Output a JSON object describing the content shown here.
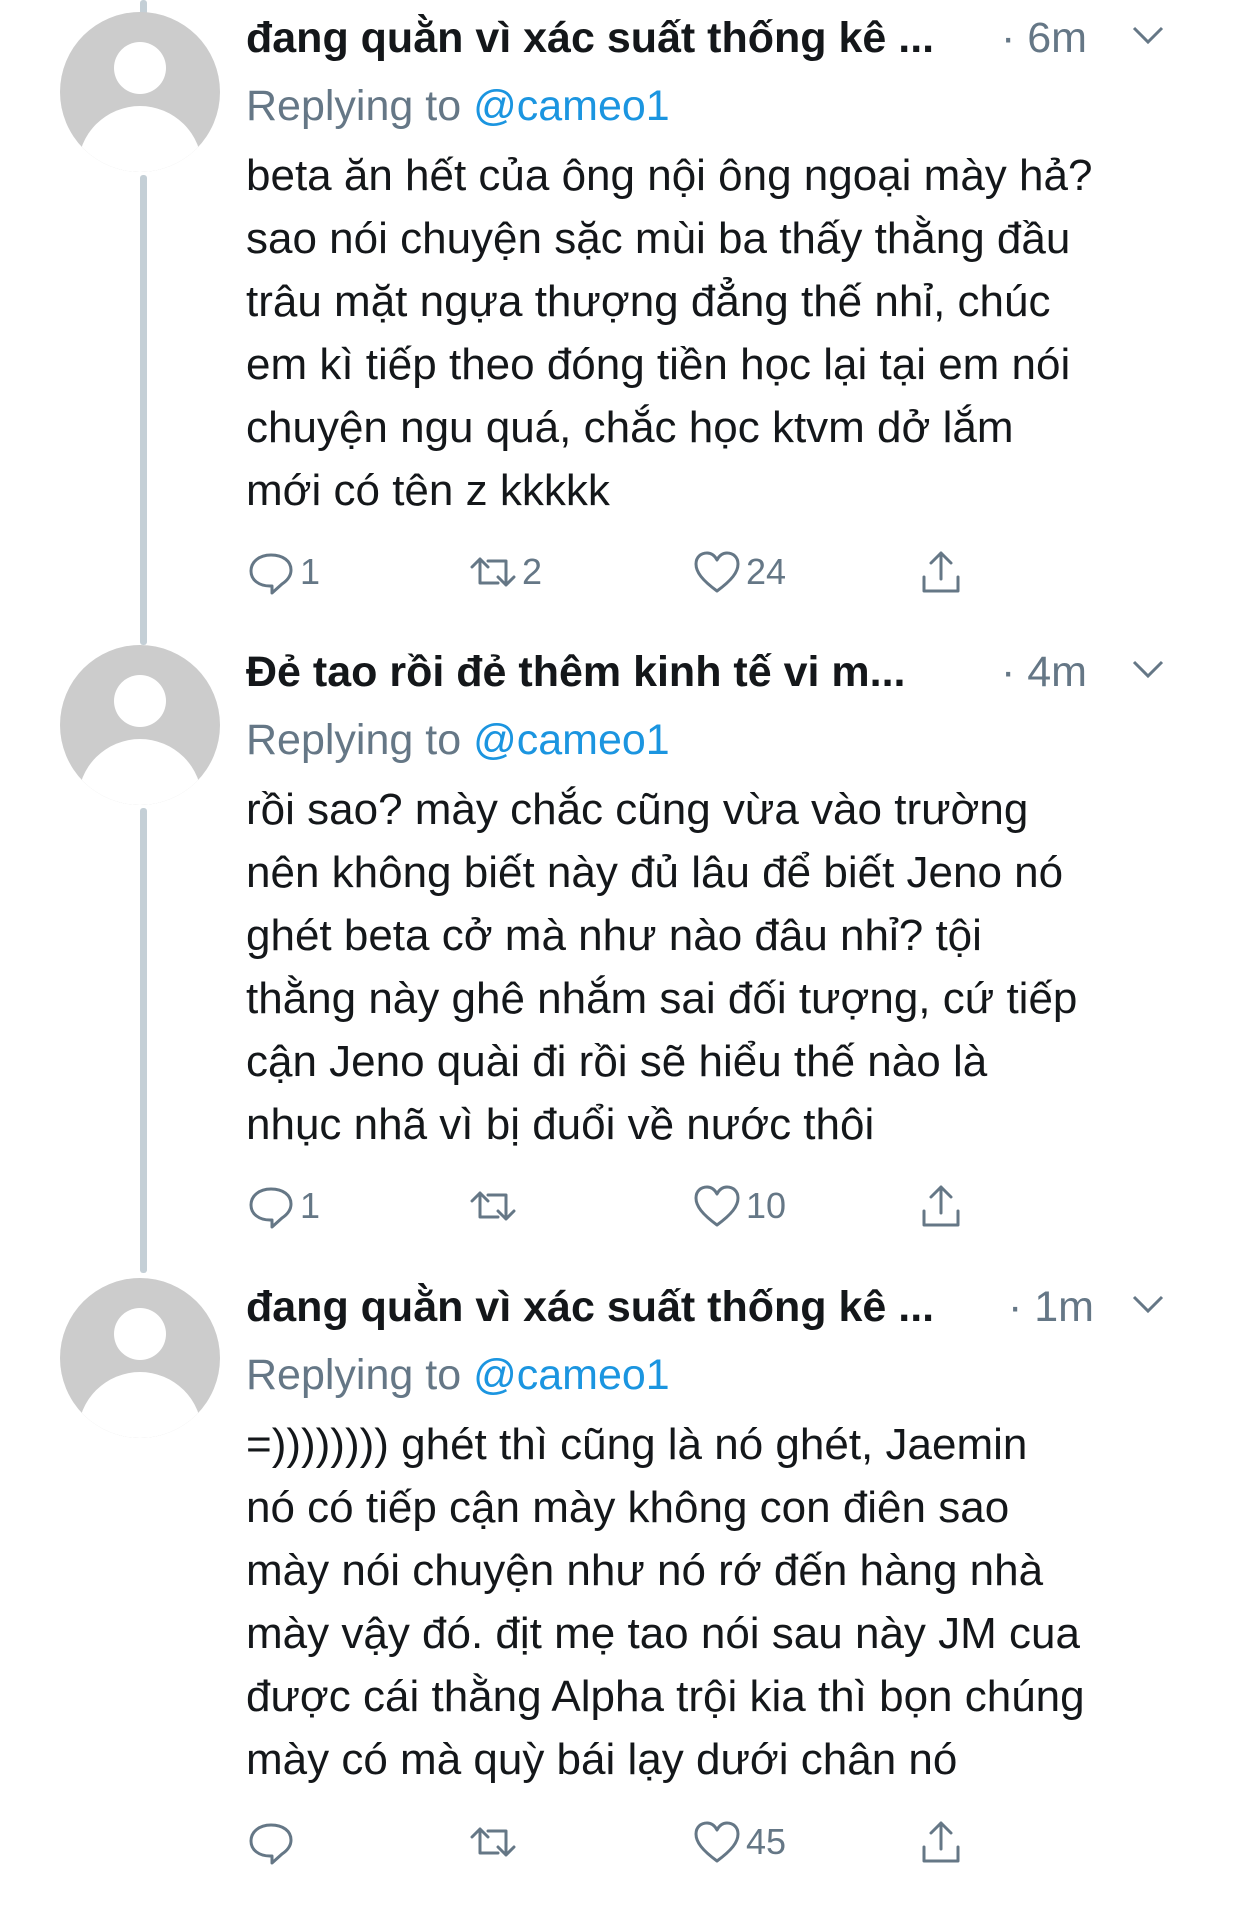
{
  "tweets": [
    {
      "name": "đang quằn vì xác suất thống kê ...",
      "time": "· 6m",
      "replying_label": "Replying to",
      "replying_handle": "@cameo1",
      "lines": [
        "beta ăn hết của ông nội ông ngoại mày hả?",
        "sao nói chuyện sặc mùi ba thấy thằng đầu",
        "trâu mặt ngựa thượng đẳng thế nhỉ, chúc",
        "em kì tiếp theo đóng tiền học lại tại em nói",
        "chuyện ngu quá, chắc học ktvm dở lắm",
        "mới có tên z kkkkk"
      ],
      "reply_count": "1",
      "retweet_count": "2",
      "like_count": "24"
    },
    {
      "name": "Đẻ tao rồi đẻ thêm kinh tế vi m...",
      "time": "· 4m",
      "replying_label": "Replying to",
      "replying_handle": "@cameo1",
      "lines": [
        "rồi sao? mày chắc cũng vừa vào trường",
        "nên không biết này đủ lâu để biết Jeno nó",
        "ghét beta cở mà như nào đâu nhỉ? tội",
        "thằng này ghê nhắm sai đối tượng, cứ tiếp",
        "cận Jeno quài đi rồi sẽ hiểu thế nào là",
        "nhục nhã vì bị đuổi về nước thôi"
      ],
      "reply_count": "1",
      "retweet_count": "",
      "like_count": "10"
    },
    {
      "name": "đang quằn vì xác suất thống kê ...",
      "time": "· 1m",
      "replying_label": "Replying to",
      "replying_handle": "@cameo1",
      "lines": [
        "=)))))))) ghét thì cũng là nó ghét, Jaemin",
        "nó có tiếp cận mày không con điên sao",
        "mày nói chuyện như nó rớ đến hàng nhà",
        "mày vậy đó. địt mẹ tao nói sau này JM cua",
        "được cái thằng Alpha trội kia thì bọn chúng",
        "mày có mà quỳ bái lạy dưới chân nó"
      ],
      "reply_count": "",
      "retweet_count": "",
      "like_count": "45"
    }
  ],
  "icons": {
    "reply": "reply-icon",
    "retweet": "retweet-icon",
    "like": "heart-icon",
    "share": "share-icon",
    "menu": "chevron-down-icon"
  },
  "colors": {
    "secondary_text": "#657786",
    "link": "#1b95e0",
    "thread_line": "#c4cfd6",
    "avatar": "#cccccc"
  }
}
